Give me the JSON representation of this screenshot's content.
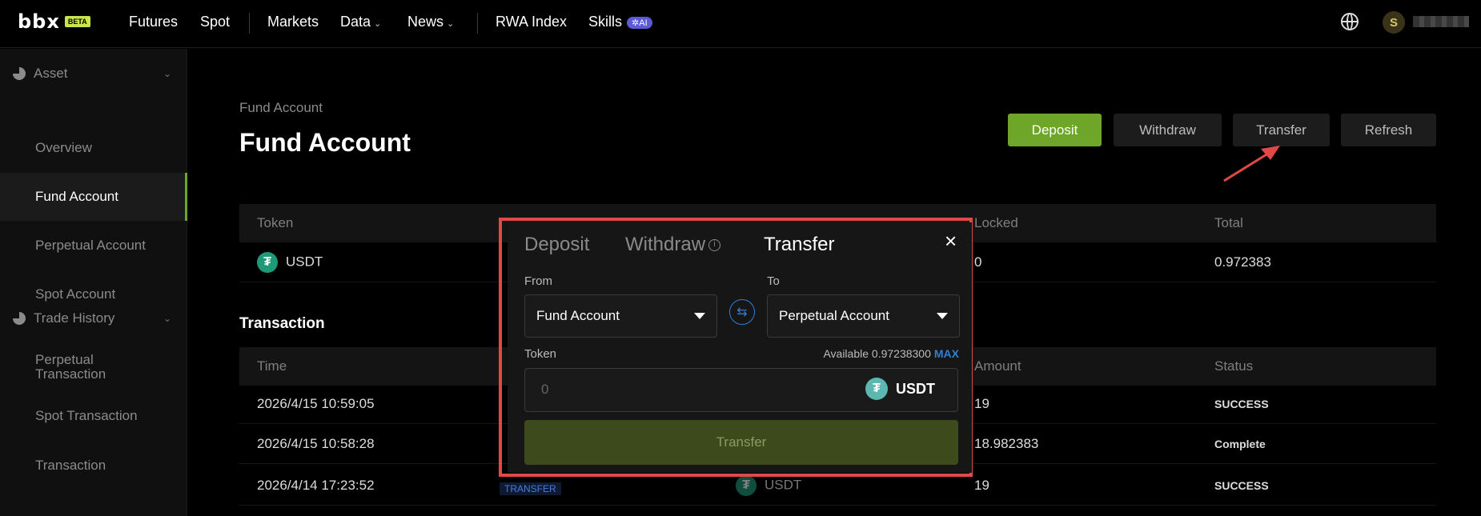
{
  "nav": {
    "logo": "bbx",
    "beta": "BETA",
    "items": [
      "Futures",
      "Spot",
      "Markets",
      "Data",
      "News",
      "RWA Index",
      "Skills"
    ],
    "ai_badge": "AI",
    "avatar_letter": "S"
  },
  "sidebar": {
    "groups": [
      {
        "label": "Asset",
        "items": [
          "Overview",
          "Fund Account",
          "Perpetual Account",
          "Spot Account"
        ]
      },
      {
        "label": "Trade History",
        "items": [
          "Perpetual Transaction",
          "Spot Transaction",
          "Transaction"
        ]
      }
    ],
    "active": "Fund Account"
  },
  "main": {
    "breadcrumb": "Fund Account",
    "title": "Fund Account",
    "buttons": [
      "Deposit",
      "Withdraw",
      "Transfer",
      "Refresh"
    ],
    "balances": {
      "headers": [
        "Token",
        "Locked",
        "Total"
      ],
      "rows": [
        {
          "token": "USDT",
          "locked": "0",
          "total": "0.972383"
        }
      ]
    },
    "transaction_title": "Transaction",
    "transactions": {
      "headers": [
        "Time",
        "Amount",
        "Status"
      ],
      "rows": [
        {
          "time": "2026/4/15 10:59:05",
          "amount": "19",
          "status": "SUCCESS"
        },
        {
          "time": "2026/4/15 10:58:28",
          "amount": "18.982383",
          "status": "Complete"
        },
        {
          "time": "2026/4/14 17:23:52",
          "type": "TRANSFER",
          "token": "USDT",
          "amount": "19",
          "status": "SUCCESS"
        }
      ]
    }
  },
  "modal": {
    "tabs": [
      "Deposit",
      "Withdraw",
      "Transfer"
    ],
    "active_tab": "Transfer",
    "from_label": "From",
    "to_label": "To",
    "from_value": "Fund Account",
    "to_value": "Perpetual Account",
    "token_label": "Token",
    "available_label": "Available",
    "available_value": "0.97238300",
    "max_label": "MAX",
    "amount_placeholder": "0",
    "token": "USDT",
    "submit_label": "Transfer"
  },
  "colors": {
    "accent": "#6ea62a",
    "highlight_border": "#e24848",
    "link": "#2f7ed8"
  }
}
